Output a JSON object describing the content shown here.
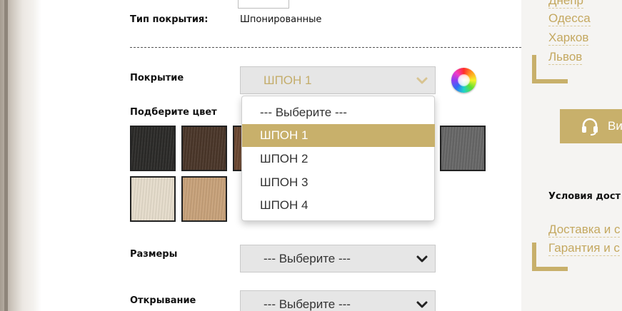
{
  "form": {
    "coating_type": {
      "label": "Тип покрытия:",
      "value": "Шпонированные"
    },
    "coating": {
      "label": "Покрытие",
      "selected": "ШПОН 1"
    },
    "pick_color_label": "Подберите цвет",
    "sizes": {
      "label": "Размеры",
      "selected": "--- Выберите ---"
    },
    "opening": {
      "label": "Открывание",
      "selected": "--- Выберите ---"
    }
  },
  "dropdown": {
    "options": [
      "--- Выберите ---",
      "ШПОН 1",
      "ШПОН 2",
      "ШПОН 3",
      "ШПОН 4"
    ],
    "highlighted_index": 1
  },
  "swatches": [
    {
      "name": "black",
      "color": "#2b2a28"
    },
    {
      "name": "dark-brown",
      "color": "#4a3629"
    },
    {
      "name": "walnut",
      "color": "#6e4a33"
    },
    {
      "name": "grey",
      "color": "#676767"
    },
    {
      "name": "bleached-oak",
      "color": "#e6ddcc"
    },
    {
      "name": "natural-oak",
      "color": "#c8a27a"
    }
  ],
  "sidebar": {
    "cities": [
      "Днепр",
      "Одесса",
      "Харков",
      "Львов"
    ],
    "call_button_label": "Ви",
    "delivery_title": "Условия дост",
    "links": [
      "Доставка и с",
      "Гарантия и с"
    ]
  },
  "colors": {
    "accent": "#c8b06b",
    "link": "#c4a860"
  }
}
